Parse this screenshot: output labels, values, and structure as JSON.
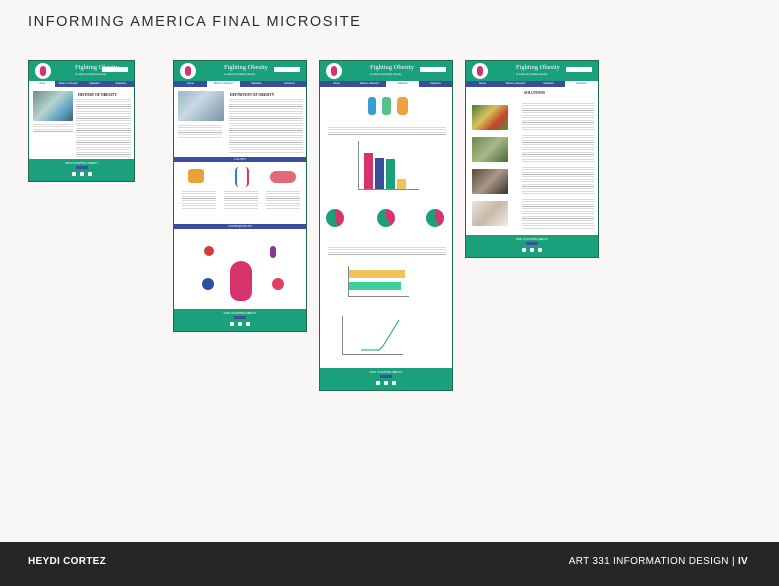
{
  "heading": "INFORMING AMERICA FINAL MICROSITE",
  "footer": {
    "author": "HEYDI CORTEZ",
    "course": "ART 331 INFORMATION DESIGN",
    "separator": "|",
    "page_number": "IV"
  },
  "site": {
    "name": "Fighting Obesity",
    "tagline": "to adopt and defeat obesity",
    "nav": [
      "Home",
      "What is Obesity?",
      "Statistics",
      "Solutions"
    ],
    "footer_line": "WHAT IS FIGHTING OBESITY"
  },
  "pages": [
    {
      "active": 0,
      "sections": [
        "HISTORY OF OBESITY"
      ]
    },
    {
      "active": 1,
      "sections": [
        "DEFINITION OF OBESITY",
        "CAUSES",
        "CONSEQUENCES"
      ]
    },
    {
      "active": 2,
      "sections": []
    },
    {
      "active": 3,
      "sections": [
        "SOLUTIONS"
      ]
    }
  ],
  "colors": {
    "accent": "#1aa07a",
    "nav": "#3a4f9b",
    "pink": "#d6326c"
  }
}
